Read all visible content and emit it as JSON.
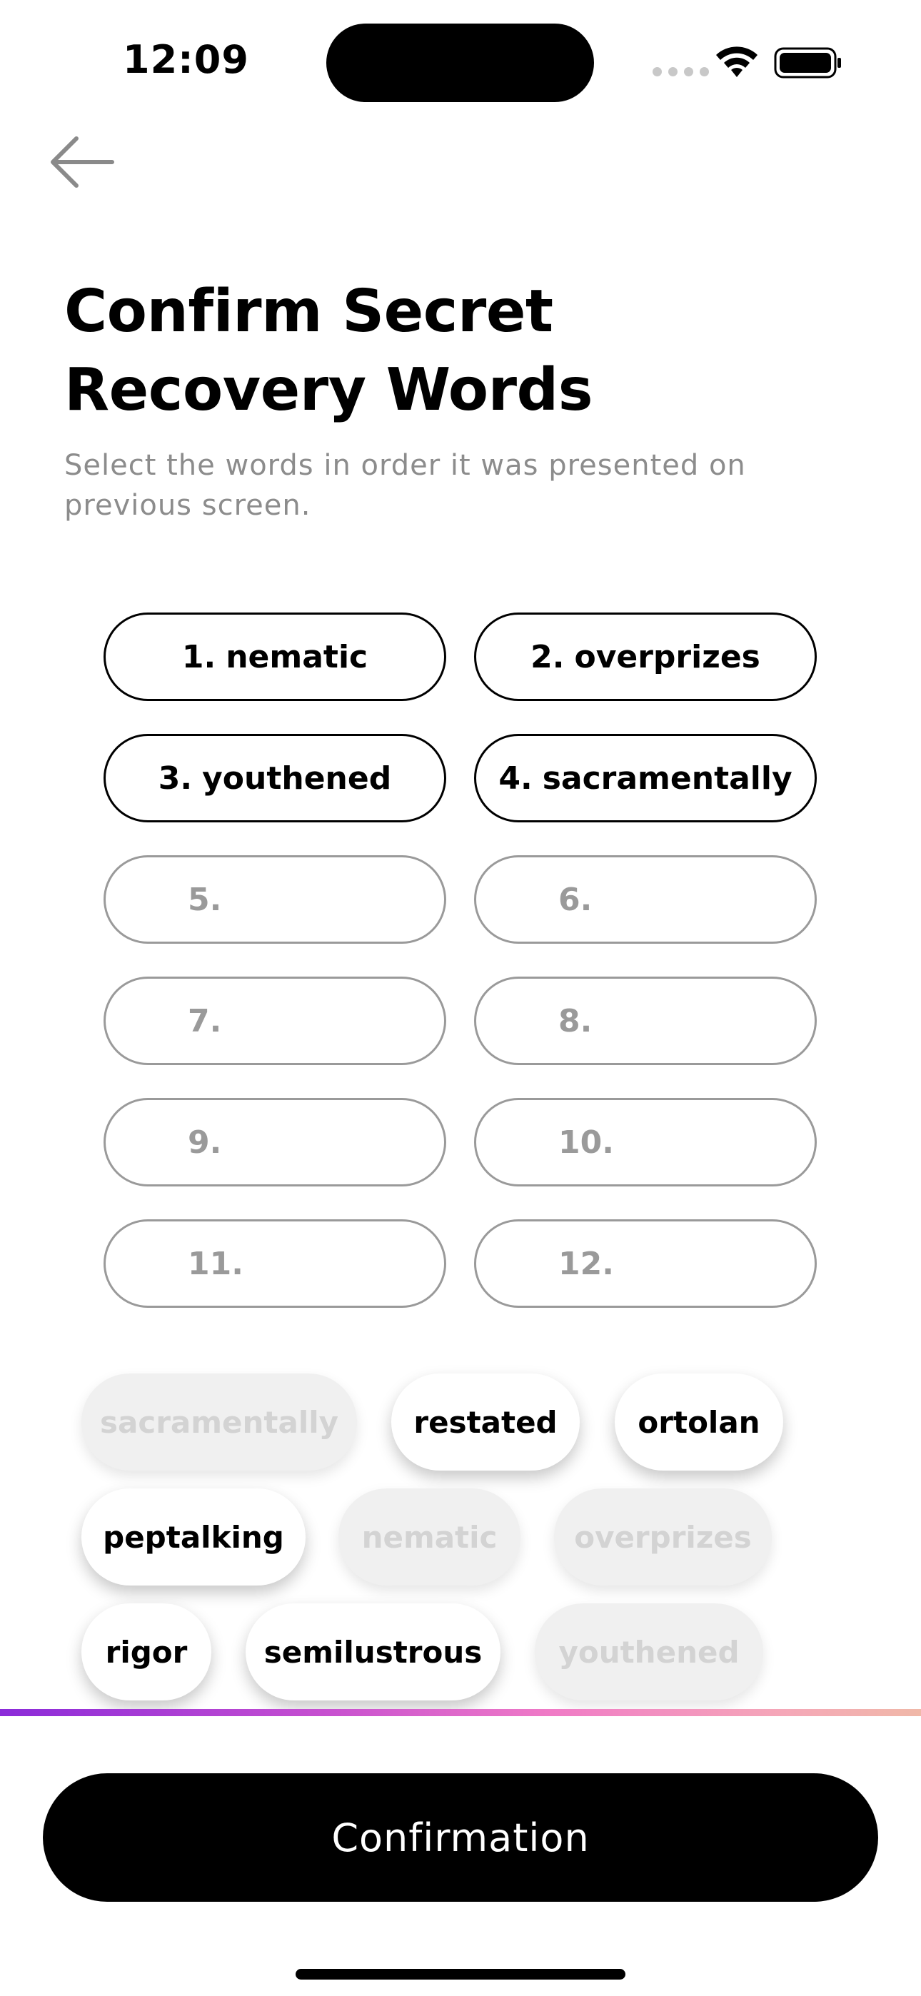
{
  "status_bar": {
    "time": "12:09",
    "wifi_icon": "wifi-icon",
    "battery_icon": "battery-icon"
  },
  "header": {
    "back_icon": "arrow-left-icon",
    "title_line1": "Confirm Secret",
    "title_line2": "Recovery Words",
    "subtitle": "Select the words in order it was presented on previous screen."
  },
  "slots": [
    {
      "number": "1.",
      "word": "nematic",
      "filled": true
    },
    {
      "number": "2.",
      "word": "overprizes",
      "filled": true
    },
    {
      "number": "3.",
      "word": "youthened",
      "filled": true
    },
    {
      "number": "4.",
      "word": "sacramentally",
      "filled": true
    },
    {
      "number": "5.",
      "word": "",
      "filled": false
    },
    {
      "number": "6.",
      "word": "",
      "filled": false
    },
    {
      "number": "7.",
      "word": "",
      "filled": false
    },
    {
      "number": "8.",
      "word": "",
      "filled": false
    },
    {
      "number": "9.",
      "word": "",
      "filled": false
    },
    {
      "number": "10.",
      "word": "",
      "filled": false
    },
    {
      "number": "11.",
      "word": "",
      "filled": false
    },
    {
      "number": "12.",
      "word": "",
      "filled": false
    }
  ],
  "word_choices": [
    {
      "word": "sacramentally",
      "used": true
    },
    {
      "word": "restated",
      "used": false
    },
    {
      "word": "ortolan",
      "used": false
    },
    {
      "word": "peptalking",
      "used": false
    },
    {
      "word": "nematic",
      "used": true
    },
    {
      "word": "overprizes",
      "used": true
    },
    {
      "word": "rigor",
      "used": false
    },
    {
      "word": "semilustrous",
      "used": false
    },
    {
      "word": "youthened",
      "used": true
    }
  ],
  "footer": {
    "confirm_label": "Confirmation"
  },
  "colors": {
    "primary": "#000000",
    "muted_text": "#8c8c8c",
    "slot_empty_border": "#9a9a9a",
    "chip_used_bg": "#f0f0f0",
    "chip_used_text": "#d3d3d3",
    "gradient_start": "#8b2bd9",
    "gradient_end": "#f0b8a8"
  }
}
